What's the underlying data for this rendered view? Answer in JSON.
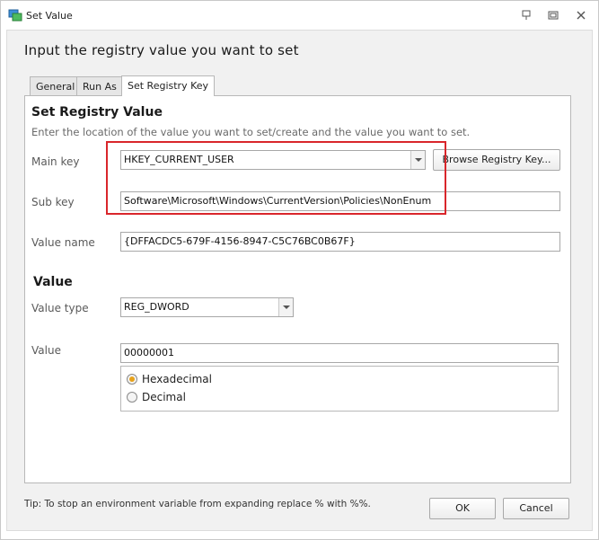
{
  "window": {
    "title": "Set Value"
  },
  "heading": "Input the registry value you want to set",
  "tabs": [
    {
      "label": "General",
      "active": false
    },
    {
      "label": "Run As",
      "active": false
    },
    {
      "label": "Set Registry Key",
      "active": true
    }
  ],
  "registry": {
    "section_title": "Set Registry Value",
    "description": "Enter the location of the value you want to set/create and the value you want to set.",
    "main_key": {
      "label": "Main key",
      "value": "HKEY_CURRENT_USER"
    },
    "browse_button": "Browse Registry Key...",
    "sub_key": {
      "label": "Sub key",
      "value": "Software\\Microsoft\\Windows\\CurrentVersion\\Policies\\NonEnum"
    },
    "value_name": {
      "label": "Value name",
      "value": "{DFFACDC5-679F-4156-8947-C5C76BC0B67F}"
    }
  },
  "value_section": {
    "section_title": "Value",
    "value_type": {
      "label": "Value type",
      "value": "REG_DWORD"
    },
    "value": {
      "label": "Value",
      "value": "00000001"
    },
    "radios": [
      {
        "label": "Hexadecimal",
        "checked": true
      },
      {
        "label": "Decimal",
        "checked": false
      }
    ]
  },
  "tip": "Tip: To stop an environment variable from expanding replace % with %%.",
  "buttons": {
    "ok": "OK",
    "cancel": "Cancel"
  },
  "colors": {
    "highlight": "#d9262b",
    "radio_selected": "#e7a21c"
  }
}
